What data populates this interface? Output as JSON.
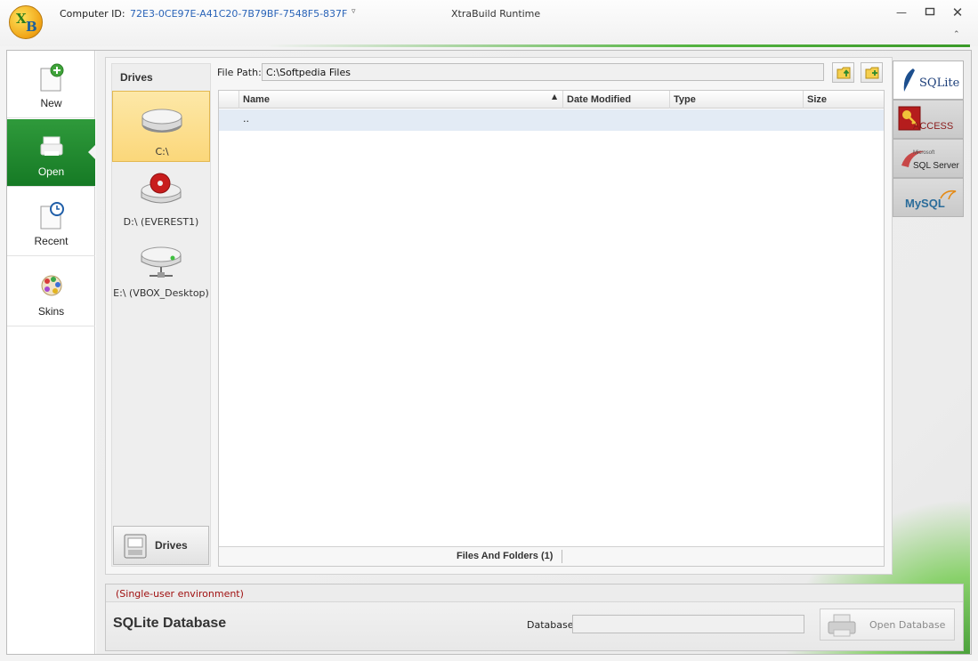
{
  "titlebar": {
    "computer_id_label": "Computer ID:",
    "computer_id_value": "72E3-0CE97E-A41C20-7B79BF-7548F5-837F",
    "app_title": "XtraBuild Runtime",
    "logo_letters": [
      "X",
      "B"
    ]
  },
  "nav": {
    "items": [
      {
        "label": "New",
        "icon": "new-document-icon"
      },
      {
        "label": "Open",
        "icon": "open-printer-icon",
        "active": true
      },
      {
        "label": "Recent",
        "icon": "recent-clock-icon"
      },
      {
        "label": "Skins",
        "icon": "skins-palette-icon"
      }
    ]
  },
  "drives": {
    "title": "Drives",
    "items": [
      {
        "label": "C:\\",
        "icon": "hard-drive-icon",
        "selected": true
      },
      {
        "label": "D:\\ (EVEREST1)",
        "icon": "dvd-drive-icon"
      },
      {
        "label": "E:\\ (VBOX_Desktop)",
        "icon": "network-drive-icon"
      }
    ],
    "button_label": "Drives"
  },
  "file_path": {
    "label": "File Path:",
    "value": "C:\\Softpedia Files"
  },
  "grid": {
    "columns": [
      "Name",
      "Date Modified",
      "Type",
      "Size"
    ],
    "rows": [
      {
        "name": ".."
      }
    ],
    "footer": "Files And Folders (1)"
  },
  "db_tabs": [
    {
      "label": "SQLite",
      "active": true
    },
    {
      "label": "ACCESS"
    },
    {
      "label": "SQL Server",
      "sub": "Microsoft"
    },
    {
      "label": "MySQL"
    }
  ],
  "bottom": {
    "environment": "(Single-user environment)",
    "title": "SQLite Database",
    "database_label": "Database",
    "database_value": "",
    "open_button": "Open Database"
  },
  "colors": {
    "accent_green": "#167a25",
    "link_blue": "#2a64b8",
    "env_red": "#a01010",
    "selected_drive": "#fbd77a",
    "selected_row": "#e3ebf5"
  }
}
